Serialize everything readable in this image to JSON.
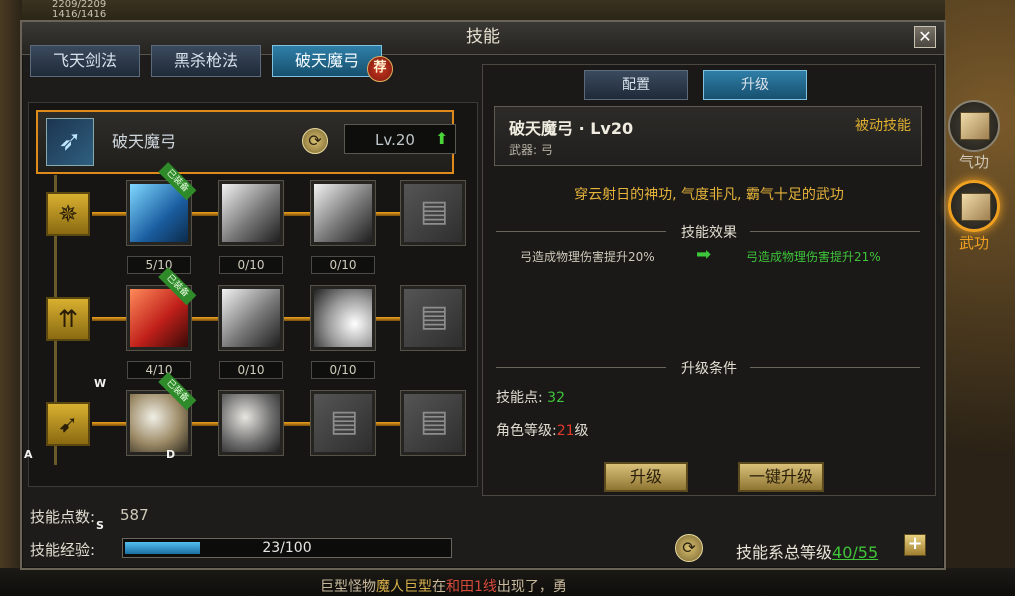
{
  "hud": {
    "hp_line1": "2209/2209",
    "hp_line2": "1416/1416"
  },
  "ticker": {
    "prefix": "巨型怪物",
    "monster": "魔人巨型",
    "mid": "在",
    "place": "和田1线",
    "suffix": "出现了，勇"
  },
  "window": {
    "title": "技能",
    "close": "✕"
  },
  "tabs": [
    {
      "label": "飞天剑法",
      "active": false
    },
    {
      "label": "黑杀枪法",
      "active": false
    },
    {
      "label": "破天魔弓",
      "active": true
    }
  ],
  "recommend_badge": "荐",
  "current_skill": {
    "name": "破天魔弓",
    "level": "Lv.20",
    "icon": "bow-icon"
  },
  "tree": {
    "rows": [
      {
        "row_icon": "arrow-burst-icon",
        "slots": [
          {
            "art": "blue",
            "equipped": true,
            "count": "5/10"
          },
          {
            "art": "gray",
            "equipped": false,
            "count": "0/10"
          },
          {
            "art": "gray",
            "equipped": false,
            "count": "0/10"
          },
          {
            "art": "locked",
            "equipped": false,
            "count": ""
          }
        ]
      },
      {
        "row_icon": "multi-arrow-icon",
        "slots": [
          {
            "art": "red",
            "equipped": true,
            "count": "4/10"
          },
          {
            "art": "gray",
            "equipped": false,
            "count": "0/10"
          },
          {
            "art": "white",
            "equipped": false,
            "count": "0/10"
          },
          {
            "art": "locked",
            "equipped": false,
            "count": ""
          }
        ]
      },
      {
        "row_icon": "feather-arrow-icon",
        "slots": [
          {
            "art": "eagle",
            "equipped": true,
            "count": ""
          },
          {
            "art": "hawk",
            "equipped": false,
            "count": ""
          },
          {
            "art": "locked",
            "equipped": false,
            "count": ""
          },
          {
            "art": "locked",
            "equipped": false,
            "count": ""
          }
        ]
      }
    ],
    "equipped_label": "已装备"
  },
  "key_hints": {
    "w": "W",
    "a": "A",
    "s": "S",
    "d": "D"
  },
  "stats": {
    "points_label": "技能点数:",
    "points_value": "587",
    "exp_label": "技能经验:",
    "exp_text": "23/100",
    "exp_fraction": 0.23
  },
  "right": {
    "tabs": [
      {
        "label": "配置",
        "active": false
      },
      {
        "label": "升级",
        "active": true
      }
    ],
    "title": "破天魔弓 · Lv20",
    "type": "被动技能",
    "weapon": "武器: 弓",
    "description": "穿云射日的神功, 气度非凡, 霸气十足的武功",
    "effect_title": "技能效果",
    "effect_current": "弓造成物理伤害提升20%",
    "effect_next": "弓造成物理伤害提升21%",
    "condition_title": "升级条件",
    "cond_points_label": "技能点:",
    "cond_points_value": "32",
    "cond_level_label": "角色等级:",
    "cond_level_value": "21",
    "cond_level_suffix": "级",
    "upgrade_button": "升级",
    "quick_upgrade_button": "一键升级"
  },
  "system": {
    "label": "技能系总等级",
    "value": "40/55",
    "plus": "+"
  },
  "side": {
    "qigong": "气功",
    "wugong": "武功"
  }
}
